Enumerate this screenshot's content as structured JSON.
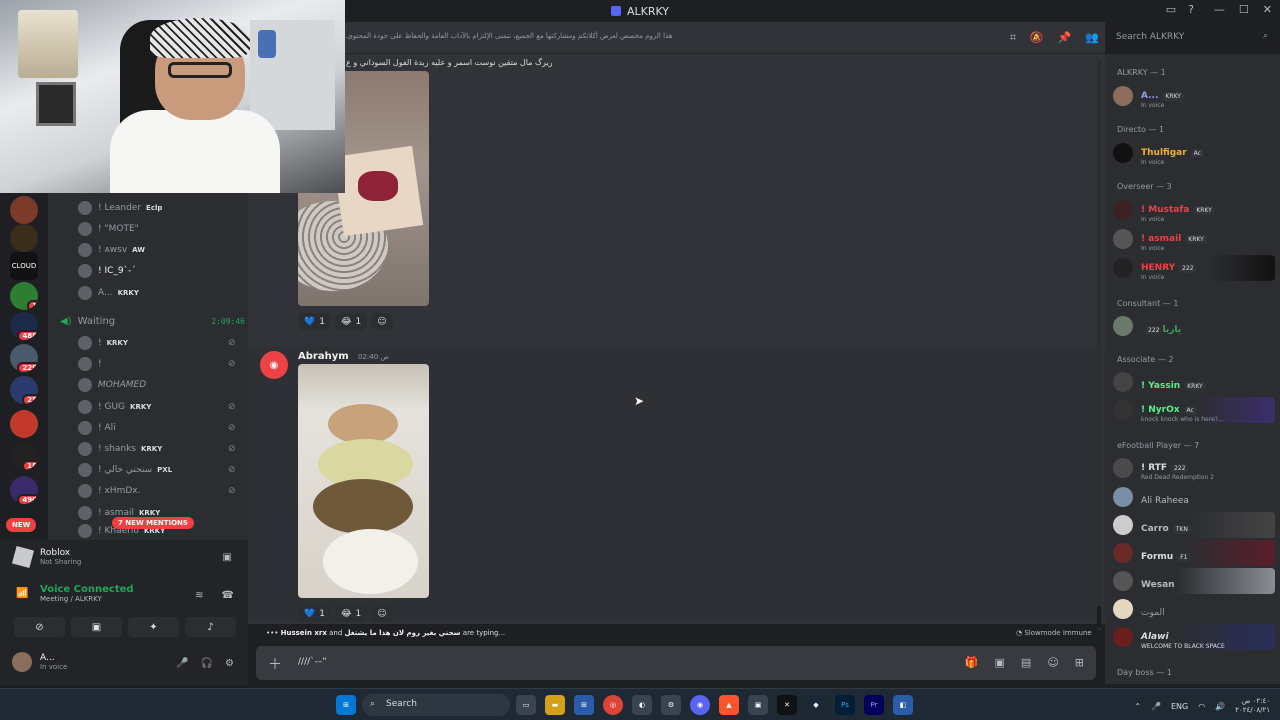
{
  "window": {
    "title": "ALKRKY"
  },
  "topic": ".هذا الروم مخصص لعرض أكلاتكم ومشاركتها مع الجميع، نتمنى الإلتزام بالآداب العامة والحفاظ على جودة المحتوى",
  "search": {
    "placeholder": "Search ALKRKY"
  },
  "rail": {
    "badges": [
      "1",
      "488",
      "229",
      "25",
      "18",
      "490"
    ],
    "server_labels": [
      "CLOUD"
    ],
    "new_label": "NEW"
  },
  "voice_members_top": [
    {
      "name": "! Leander",
      "tag": "Eclp"
    },
    {
      "name": "! \"MOTE\"",
      "tag": ""
    },
    {
      "name": "! ᴀᴡꜱᴠ",
      "tag": "AW"
    },
    {
      "name": "! IC_9`-´",
      "tag": ""
    },
    {
      "name": "A...",
      "tag": "KRKY"
    }
  ],
  "voice_channel": {
    "name": "Waiting",
    "timer": "2:09:46"
  },
  "voice_members_waiting": [
    {
      "name": "!",
      "tag": "KRKY"
    },
    {
      "name": "!",
      "tag": ""
    },
    {
      "name": "MOHAMED",
      "tag": ""
    },
    {
      "name": "! GUG",
      "tag": "KRKY"
    },
    {
      "name": "! Ali",
      "tag": ""
    },
    {
      "name": "! shanks",
      "tag": "KRKY"
    },
    {
      "name": "! سنحني خالي",
      "tag": "PXL"
    },
    {
      "name": "! xHmDx.",
      "tag": ""
    },
    {
      "name": "! asmail",
      "tag": "KRKY"
    },
    {
      "name": "! Khaerio",
      "tag": "KRKY"
    }
  ],
  "mentions_pill": "7 NEW MENTIONS",
  "activity": {
    "title": "Roblox",
    "status": "Not Sharing"
  },
  "voice_status": {
    "title": "Voice Connected",
    "sub": "Meeting / ALKRKY"
  },
  "user": {
    "name": "A...",
    "status": "In voice"
  },
  "messages": {
    "first_text": "ريرگ مال متقين نوست اسمر و عليه زبدة الفول السوداني و ع",
    "reactions": [
      {
        "emoji": "💙",
        "count": "1"
      },
      {
        "emoji": "😂",
        "count": "1"
      }
    ],
    "second_author": "Abrahym",
    "second_time": "02:40 ص",
    "reactions2": [
      {
        "emoji": "💙",
        "count": "1"
      },
      {
        "emoji": "😂",
        "count": "1"
      }
    ]
  },
  "typing": {
    "users": "Hussein xrx",
    "and": "and",
    "user2": "سحني بغير روم لان هذا ما يشتغل",
    "suffix": "are typing..."
  },
  "slowmode": "Slowmode Immune",
  "composer": {
    "text": "////`-–\""
  },
  "member_groups": [
    {
      "header": "ALKRKY — 1",
      "members": [
        {
          "name": "A...",
          "tag": "KRKY",
          "sub": "In voice",
          "color": "#8ea1e1"
        }
      ]
    },
    {
      "header": "Directo — 1",
      "members": [
        {
          "name": "Thulfigar",
          "tag": "Ac",
          "sub": "In voice",
          "color": "#f0b232"
        }
      ]
    },
    {
      "header": "Overseer — 3",
      "members": [
        {
          "name": "! Mustafa",
          "tag": "KRKY",
          "sub": "In voice",
          "color": "#ed4245"
        },
        {
          "name": "! asmail",
          "tag": "KRKY",
          "sub": "In voice",
          "color": "#ed4245"
        },
        {
          "name": "HENRY",
          "tag": "222",
          "sub": "In voice",
          "color": "#ed4245"
        }
      ]
    },
    {
      "header": "Consultant — 1",
      "members": [
        {
          "name": "ياريا",
          "tag": "222",
          "sub": "",
          "color": "#3ba55d"
        }
      ]
    },
    {
      "header": "Associate — 2",
      "members": [
        {
          "name": "! Yassin",
          "tag": "KRKY",
          "sub": "",
          "color": "#57f287"
        },
        {
          "name": "! NyrOx",
          "tag": "Ac",
          "sub": "knock knock who is here?...",
          "color": "#57f287"
        }
      ]
    },
    {
      "header": "eFootball Player — 7",
      "members": [
        {
          "name": "! RTF",
          "tag": "222",
          "sub": "Red Dead Redemption 2",
          "color": "#dbdee1"
        },
        {
          "name": "Ali Raheea",
          "tag": "",
          "sub": "",
          "color": "#dbdee1"
        },
        {
          "name": "Carro",
          "tag": "TKN",
          "sub": "",
          "color": "#dbdee1"
        },
        {
          "name": "Formu",
          "tag": "F1",
          "sub": "",
          "color": "#dbdee1"
        },
        {
          "name": "Wesan",
          "tag": "",
          "sub": "",
          "color": "#dbdee1"
        },
        {
          "name": "الموت",
          "tag": "",
          "sub": "",
          "color": "#dbdee1"
        },
        {
          "name": "Alawi",
          "tag": "",
          "sub": "WELCOME TO BLACK SPACE",
          "color": "#dbdee1"
        }
      ]
    },
    {
      "header": "Day boss — 1",
      "members": []
    }
  ],
  "taskbar": {
    "search": "Search",
    "lang": "ENG",
    "time": "٠٢:٤٠ ص",
    "date": "٢٠٢٤/٠٨/٢١"
  }
}
